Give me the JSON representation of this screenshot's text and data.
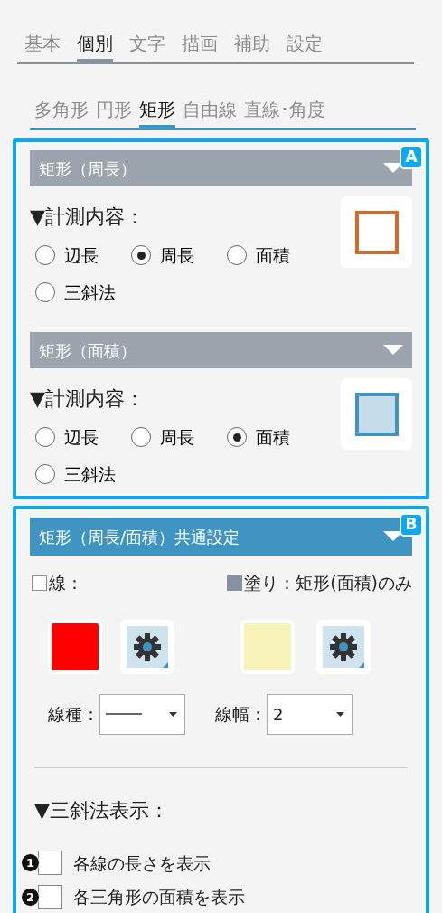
{
  "main_tabs": [
    {
      "label": "基本",
      "selected": false
    },
    {
      "label": "個別",
      "selected": true
    },
    {
      "label": "文字",
      "selected": false
    },
    {
      "label": "描画",
      "selected": false
    },
    {
      "label": "補助",
      "selected": false
    },
    {
      "label": "設定",
      "selected": false
    }
  ],
  "sub_tabs": [
    {
      "label": "多角形",
      "selected": false
    },
    {
      "label": "円形",
      "selected": false
    },
    {
      "label": "矩形",
      "selected": true
    },
    {
      "label": "自由線",
      "selected": false
    },
    {
      "label": "直線･角度",
      "selected": false
    }
  ],
  "group_a": {
    "badge": "A",
    "panels": [
      {
        "title": "矩形（周長）",
        "heading": "▼計測内容：",
        "kind": "outline",
        "options": [
          {
            "label": "辺長",
            "selected": false
          },
          {
            "label": "周長",
            "selected": true
          },
          {
            "label": "面積",
            "selected": false
          },
          {
            "label": "三斜法",
            "selected": false
          }
        ]
      },
      {
        "title": "矩形（面積）",
        "heading": "▼計測内容：",
        "kind": "filled",
        "options": [
          {
            "label": "辺長",
            "selected": false
          },
          {
            "label": "周長",
            "selected": false
          },
          {
            "label": "面積",
            "selected": true
          },
          {
            "label": "三斜法",
            "selected": false
          }
        ]
      }
    ]
  },
  "group_b": {
    "badge": "B",
    "title": "矩形（周長/面積）共通設定",
    "line": {
      "label": "線：",
      "checked": false,
      "color": "#ff0000"
    },
    "fill": {
      "label": "塗り：矩形(面積)のみ",
      "checked": true,
      "color": "#f7f3bb"
    },
    "line_type": {
      "label": "線種：",
      "kind": "solid"
    },
    "line_width": {
      "label": "線幅：",
      "value": "2"
    },
    "triangle_heading": "▼三斜法表示：",
    "checkboxes": [
      {
        "marker": "1",
        "label": "各線の長さを表示",
        "checked": false
      },
      {
        "marker": "2",
        "label": "各三角形の面積を表示",
        "checked": false
      }
    ]
  }
}
